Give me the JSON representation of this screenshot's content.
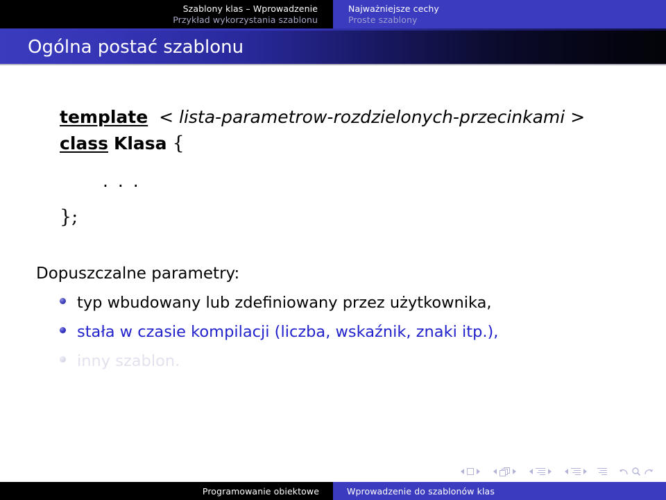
{
  "header": {
    "left": {
      "section_title": "Szablony klas – Wprowadzenie",
      "subsection_title": "Przykład wykorzystania szablonu"
    },
    "right": {
      "section_title": "Najważniejsze cechy",
      "subsection_title": "Proste szablony"
    }
  },
  "slide": {
    "title": "Ogólna postać szablonu",
    "code": {
      "line1": {
        "keyword": "template",
        "open_angle": "<",
        "parameter_list": "lista-parametrow-rozdzielonych-przecinkami",
        "close_angle": ">"
      },
      "line2": {
        "keyword": "class",
        "identifier": "Klasa",
        "open_brace": "{"
      },
      "ellipsis": ". . .",
      "close": "};"
    },
    "lead_text": "Dopuszczalne parametry:",
    "bullets": [
      {
        "text": "typ wbudowany lub zdefiniowany przez użytkownika,",
        "state": "on"
      },
      {
        "text": "stała w czasie kompilacji (liczba, wskaźnik, znaki itp.),",
        "state": "half"
      },
      {
        "text": "inny szablon.",
        "state": "off"
      }
    ]
  },
  "navigation": {
    "groups": [
      {
        "icon": "slide-square-icon",
        "label": "slide"
      },
      {
        "icon": "frame-pages-icon",
        "label": "frame"
      },
      {
        "icon": "subsection-lines-icon",
        "label": "subsection"
      },
      {
        "icon": "section-lines-icon",
        "label": "section"
      }
    ],
    "presentation_icon": "presentation-lines-icon",
    "back_icon": "back-arrow-icon",
    "search_icon": "search-magnifier-icon",
    "forward_icon": "forward-arrow-icon"
  },
  "footer": {
    "left_text": "Programowanie obiektowe",
    "right_text": "Wprowadzenie do szablonów klas"
  },
  "colors": {
    "brand_blue": "#3b3bbf",
    "header_black": "#000000",
    "bullet_active": "#000000",
    "bullet_alert": "#2222cc",
    "bullet_dimmed": "#e2e2ee",
    "nav_symbol": "#b4b4d8"
  }
}
